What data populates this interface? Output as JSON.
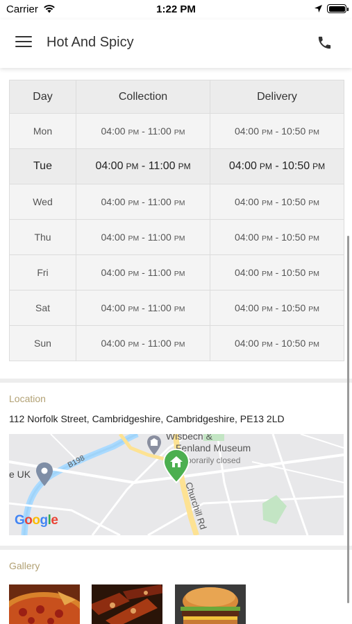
{
  "status_bar": {
    "carrier": "Carrier",
    "time": "1:22 PM"
  },
  "header": {
    "title": "Hot And Spicy"
  },
  "hours": {
    "columns": [
      "Day",
      "Collection",
      "Delivery"
    ],
    "rows": [
      {
        "day": "Mon",
        "collection_open": "04:00",
        "collection_open_ampm": "PM",
        "collection_close": "11:00",
        "collection_close_ampm": "PM",
        "delivery_open": "04:00",
        "delivery_open_ampm": "PM",
        "delivery_close": "10:50",
        "delivery_close_ampm": "PM"
      },
      {
        "day": "Tue",
        "collection_open": "04:00",
        "collection_open_ampm": "PM",
        "collection_close": "11:00",
        "collection_close_ampm": "PM",
        "delivery_open": "04:00",
        "delivery_open_ampm": "PM",
        "delivery_close": "10:50",
        "delivery_close_ampm": "PM"
      },
      {
        "day": "Wed",
        "collection_open": "04:00",
        "collection_open_ampm": "PM",
        "collection_close": "11:00",
        "collection_close_ampm": "PM",
        "delivery_open": "04:00",
        "delivery_open_ampm": "PM",
        "delivery_close": "10:50",
        "delivery_close_ampm": "PM"
      },
      {
        "day": "Thu",
        "collection_open": "04:00",
        "collection_open_ampm": "PM",
        "collection_close": "11:00",
        "collection_close_ampm": "PM",
        "delivery_open": "04:00",
        "delivery_open_ampm": "PM",
        "delivery_close": "10:50",
        "delivery_close_ampm": "PM"
      },
      {
        "day": "Fri",
        "collection_open": "04:00",
        "collection_open_ampm": "PM",
        "collection_close": "11:00",
        "collection_close_ampm": "PM",
        "delivery_open": "04:00",
        "delivery_open_ampm": "PM",
        "delivery_close": "10:50",
        "delivery_close_ampm": "PM"
      },
      {
        "day": "Sat",
        "collection_open": "04:00",
        "collection_open_ampm": "PM",
        "collection_close": "11:00",
        "collection_close_ampm": "PM",
        "delivery_open": "04:00",
        "delivery_open_ampm": "PM",
        "delivery_close": "10:50",
        "delivery_close_ampm": "PM"
      },
      {
        "day": "Sun",
        "collection_open": "04:00",
        "collection_open_ampm": "PM",
        "collection_close": "11:00",
        "collection_close_ampm": "PM",
        "delivery_open": "04:00",
        "delivery_open_ampm": "PM",
        "delivery_close": "10:50",
        "delivery_close_ampm": "PM"
      }
    ]
  },
  "location": {
    "label": "Location",
    "address": "112 Norfolk Street, Cambridgeshire, Cambridgeshire, PE13 2LD",
    "map": {
      "museum_line1": "Wisbech &",
      "museum_line2": "Fenland Museum",
      "museum_status": "porarily closed",
      "road_b198": "B198",
      "road_churchill": "Churchill Rd",
      "place_uk": "e UK",
      "google_letters": [
        "G",
        "o",
        "o",
        "g",
        "l",
        "e"
      ],
      "google_colors": [
        "#4285F4",
        "#EA4335",
        "#FBBC05",
        "#4285F4",
        "#34A853",
        "#EA4335"
      ],
      "icons": [
        "museum-pin-icon",
        "home-pin-icon",
        "place-pin-icon"
      ]
    }
  },
  "gallery": {
    "label": "Gallery",
    "items": [
      "pizza",
      "grilled-skewers",
      "burger"
    ]
  },
  "colors": {
    "section_label": "#b2a174",
    "home_pin": "#4caf50"
  }
}
